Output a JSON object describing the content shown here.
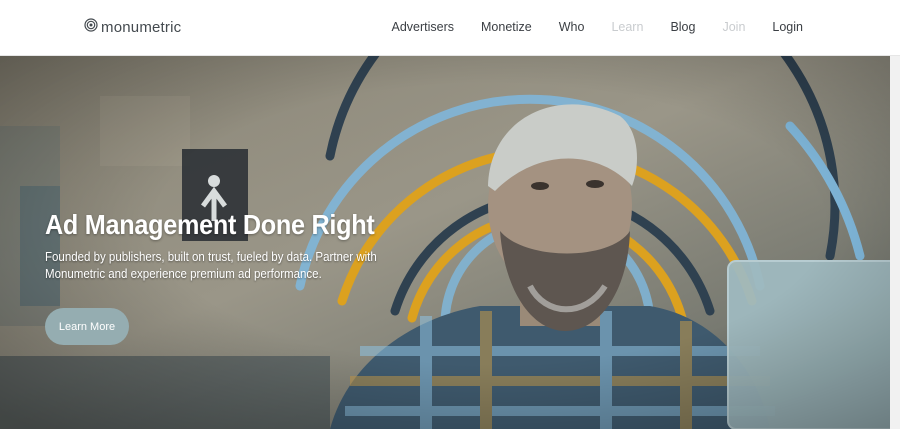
{
  "brand": {
    "name": "monumetric"
  },
  "nav": {
    "items": [
      {
        "label": "Advertisers",
        "faded": false
      },
      {
        "label": "Monetize",
        "faded": false
      },
      {
        "label": "Who",
        "faded": false
      },
      {
        "label": "Learn",
        "faded": true
      },
      {
        "label": "Blog",
        "faded": false
      },
      {
        "label": "Join",
        "faded": true
      },
      {
        "label": "Login",
        "faded": false
      }
    ]
  },
  "hero": {
    "title": "Ad Management Done Right",
    "subtitle": "Founded by publishers, built on trust, fueled by data. Partner with Monumetric and experience premium ad performance.",
    "cta_label": "Learn More"
  },
  "colors": {
    "ring_gold": "#dca11f",
    "ring_navy": "#2f4150",
    "ring_blue": "#7fb6d9",
    "cta_bg": "#95adb1"
  }
}
